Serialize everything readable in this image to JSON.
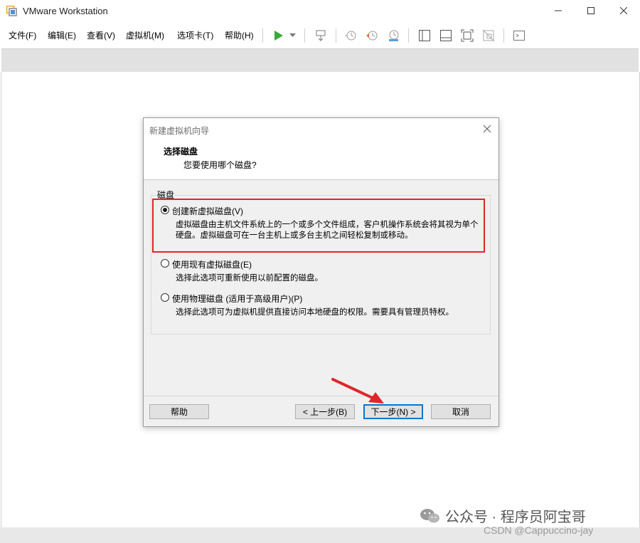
{
  "window": {
    "title": "VMware Workstation"
  },
  "menu": [
    "文件(F)",
    "编辑(E)",
    "查看(V)",
    "虚拟机(M)",
    "选项卡(T)",
    "帮助(H)"
  ],
  "dialog": {
    "title": "新建虚拟机向导",
    "heading": "选择磁盘",
    "subheading": "您要使用哪个磁盘?",
    "group_label": "磁盘",
    "options": [
      {
        "label": "创建新虚拟磁盘(V)",
        "desc": "虚拟磁盘由主机文件系统上的一个或多个文件组成，客户机操作系统会将其视为单个硬盘。虚拟磁盘可在一台主机上或多台主机之间轻松复制或移动。",
        "selected": true
      },
      {
        "label": "使用现有虚拟磁盘(E)",
        "desc": "选择此选项可重新使用以前配置的磁盘。",
        "selected": false
      },
      {
        "label": "使用物理磁盘 (适用于高级用户)(P)",
        "desc": "选择此选项可为虚拟机提供直接访问本地硬盘的权限。需要具有管理员特权。",
        "selected": false
      }
    ],
    "buttons": {
      "help": "帮助",
      "back": "< 上一步(B)",
      "next": "下一步(N) >",
      "cancel": "取消"
    }
  },
  "watermark": {
    "text": "公众号 · 程序员阿宝哥",
    "csdn": "CSDN @Cappuccino-jay"
  },
  "colors": {
    "highlight": "#e0262a",
    "play": "#3aa93a",
    "accent": "#0078d7"
  }
}
